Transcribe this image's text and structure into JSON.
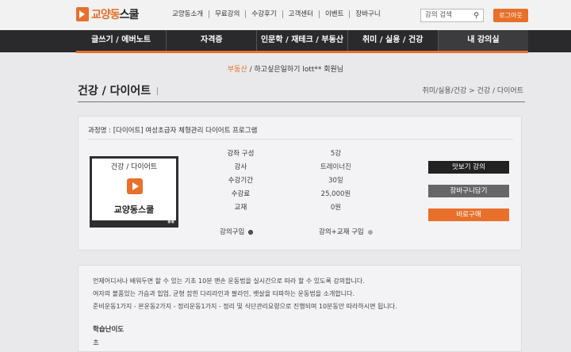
{
  "header": {
    "logo_text_a": "교양동",
    "logo_text_b": "스쿨",
    "links": [
      "교양동소개",
      "무료강의",
      "수강후기",
      "고객센터",
      "이벤트",
      "장바구니"
    ],
    "search_placeholder": "강의 검색",
    "logout_label": "로그아웃"
  },
  "nav": {
    "items": [
      "글쓰기 / 에버노트",
      "자격증",
      "인문학 / 재테크 / 부동산",
      "취미 / 실용 / 건강",
      "내 강의실"
    ]
  },
  "greeting": {
    "category": "부동산",
    "text": "/ 하고싶은일하기 lott** 회원님"
  },
  "page": {
    "title": "건강 / 다이어트",
    "breadcrumb": "취미/실용/건강 > 건강 / 다이어트"
  },
  "course": {
    "name": "과정명 : [다이어트] 여성초급자 체형관리 다이어트 프로그램",
    "thumb_category": "건강 / 다이어트",
    "thumb_brand": "교양동스쿨",
    "info": [
      {
        "label": "강좌 구성",
        "value": "5강"
      },
      {
        "label": "강사",
        "value": "트레이너진"
      },
      {
        "label": "수강기간",
        "value": "30일"
      },
      {
        "label": "수강료",
        "value": "25,000원"
      },
      {
        "label": "교재",
        "value": "0원"
      }
    ],
    "option_1": "강의구입",
    "option_2": "강의+교재 구입",
    "selected_option": "강의구입",
    "btn_preview": "맛보기 강의",
    "btn_cart": "장바구니담기",
    "btn_buy": "바로구매"
  },
  "description": {
    "lines": [
      "언제어디서나 배워두면 할 수 있는 기초 10분 맨손 운동법을 실시간으로 따라 할 수 있도록 강의합니다.",
      "여자의 볼품있는 가슴과 힙업, 균형 잡힌 다리라인과 팔라인, 뱃살을 타파하는 운동법을 소개합니다.",
      "준비운동1가지 - 본운동2가지 - 정리운동1가지 - 정리 및 식단관리요령으로 진행되며 10분동안 따라하시면 됩니다."
    ],
    "difficulty_label": "학습난이도",
    "difficulty_value": "초"
  },
  "colors": {
    "accent": "#e8702a",
    "nav_bg": "#2a2a2c"
  }
}
